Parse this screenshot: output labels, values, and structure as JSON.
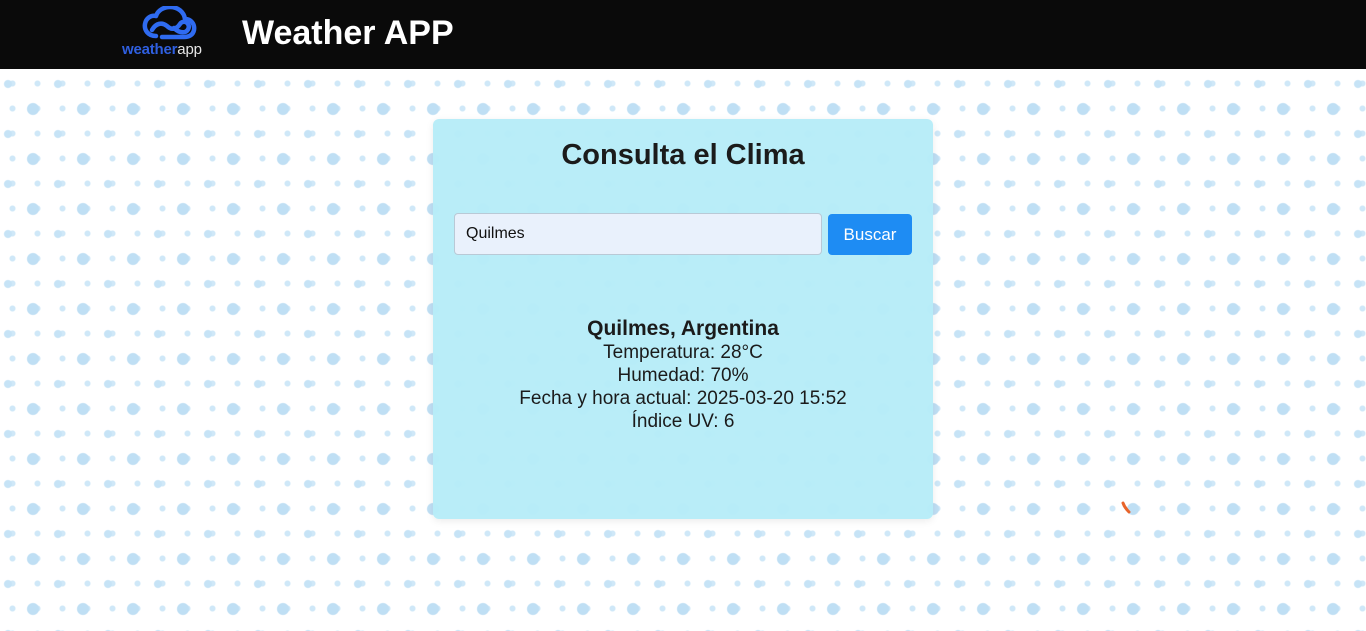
{
  "header": {
    "logo_word_primary": "weather",
    "logo_word_secondary": "app",
    "title": "Weather APP"
  },
  "card": {
    "title": "Consulta el Clima",
    "search": {
      "value": "Quilmes",
      "placeholder": "",
      "button_label": "Buscar"
    },
    "result": {
      "location": "Quilmes, Argentina",
      "temperature": "Temperatura: 28°C",
      "humidity": "Humedad: 70%",
      "datetime": "Fecha y hora actual: 2025-03-20 15:52",
      "uv_index": "Índice UV: 6"
    }
  },
  "icons": {
    "logo": "cloud-logo-icon",
    "loader": "loading-spinner-icon"
  },
  "colors": {
    "header_bg": "#0a0a0a",
    "card_bg": "#b7ecf8",
    "button_bg": "#1e8cf3",
    "dots": "#bfdff4",
    "spinner": "#e8642a"
  }
}
